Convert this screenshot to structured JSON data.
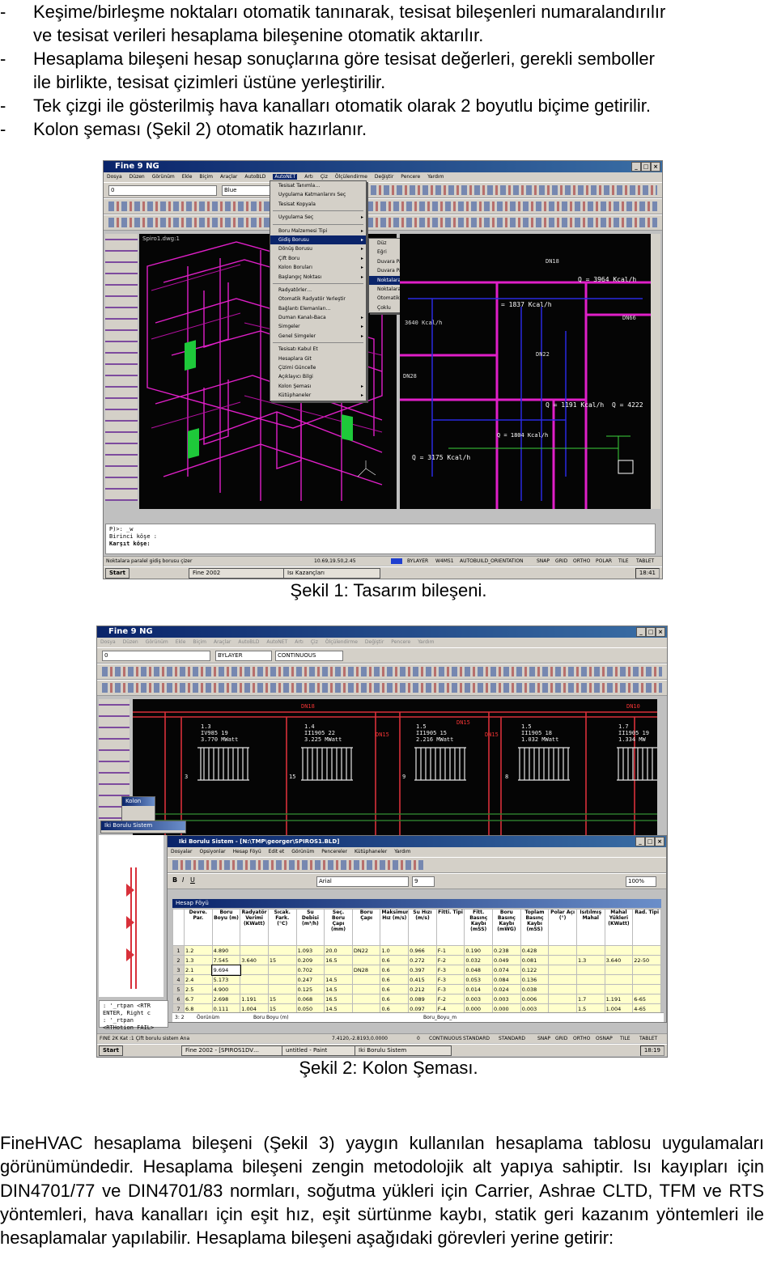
{
  "bullets": [
    {
      "dash": "-",
      "lines": [
        "Keşime/birleşme noktaları otomatik tanınarak, tesisat bileşenleri numaralandırılır",
        "ve tesisat verileri hesaplama bileşenine otomatik aktarılır."
      ]
    },
    {
      "dash": "-",
      "lines": [
        "Hesaplama bileşeni hesap sonuçlarına göre tesisat değerleri, gerekli semboller",
        "ile birlikte, tesisat çizimleri üstüne yerleştirilir."
      ]
    },
    {
      "dash": "-",
      "lines": [
        "Tek çizgi ile gösterilmiş hava kanalları otomatik olarak 2 boyutlu biçime getirilir."
      ]
    },
    {
      "dash": "-",
      "lines": [
        "Kolon şeması (Şekil 2) otomatik hazırlanır."
      ]
    }
  ],
  "figure1": {
    "caption": "Şekil 1: Tasarım bileşeni.",
    "app_title": "Fine 9 NG",
    "menubar": [
      "Dosya",
      "Düzen",
      "Görünüm",
      "Ekle",
      "Biçim",
      "Araçlar",
      "AutoBLD",
      "AutoNET",
      "Artı",
      "Çiz",
      "Ölçülendirme",
      "Değiştir",
      "Pencere",
      "Yardım"
    ],
    "layer_combo": "0",
    "color_combo": "Blue",
    "doc_title": "Spiro1.dwg:1",
    "main_menu": [
      "Tesisat Tanımla…",
      "Uygulama Katmanlarını Seç",
      "Tesisat Kopyala",
      "",
      "Uygulama Seç",
      "",
      "Boru Malzemesi Tipi",
      "Gidiş Borusu",
      "Dönüş Borusu",
      "Çift Boru",
      "Kolon Boruları",
      "Başlangıç Noktası",
      "",
      "Radyatörler…",
      "Otomatik Radyatör Yerleştir",
      "Bağlantı Elemanları…",
      "Duman Kanalı-Baca",
      "Simgeler",
      "Genel Simgeler",
      "",
      "Tesisatı Kabul Et",
      "Hesaplara Git",
      "Çizimi Güncelle",
      "Açıklayıcı Bilgi",
      "Kolon Şeması",
      "Kütüphaneler"
    ],
    "sub_menu": [
      "Düz",
      "Eğri",
      "Duvara Paralel",
      "Duvara Paralel, Radyatöre Bağlı",
      "Noktalara Paralel",
      "Noktalara Paralel, Radyatöre Bağlı",
      "Otomatik Radyatör Bağla",
      "Çoklu"
    ],
    "plan_labels": [
      "DN18",
      "Q = 3964 Kcal/h",
      "= 1837 Kcal/h",
      "3640 Kcal/h",
      "DN66",
      "DN22",
      "DN28",
      "Q = 1191 Kcal/h",
      "Q = 4222",
      "Q = 1804 Kcal/h",
      "Q = 3175 Kcal/h"
    ],
    "cmd_lines": [
      "P)>: _w",
      "Birinci köşe :",
      "Karşıt köşe:"
    ],
    "status_left": "Noktalara paralel gidiş borusu çizer",
    "status_coords": "10.69,19.50,2.45",
    "status_items": [
      "BYLAYER",
      "W4MS1",
      "AUTOBUILD_ORIENTATION",
      "SNAP",
      "GRID",
      "ORTHO",
      "POLAR",
      "TILE",
      "TABLET"
    ],
    "taskbar": {
      "start": "Start",
      "task1": "Fine 2002",
      "task2": "Isı Kazançları",
      "clock": "18:41"
    }
  },
  "figure2": {
    "caption": "Şekil 2: Kolon Şeması.",
    "app_title": "Fine 9 NG",
    "layer_combo": "0",
    "linetype_combo": "BYLAYER",
    "ltype2_combo": "CONTINUOUS",
    "riser_labels": [
      "DN18",
      "DN15",
      "DN15",
      "DN15",
      "DN10"
    ],
    "radiators": [
      {
        "id": "1.3",
        "code": "IV985 19",
        "power": "3.770 MWatt",
        "count": "3"
      },
      {
        "id": "1.4",
        "code": "II1905 22",
        "power": "3.225 MWatt",
        "count": "15"
      },
      {
        "id": "1.5",
        "code": "II1905 15",
        "power": "2.216 MWatt",
        "count": "9"
      },
      {
        "id": "1.5",
        "code": "II1905 18",
        "power": "1.032 MWatt",
        "count": "8"
      },
      {
        "id": "1.7",
        "code": "II1905 19",
        "power": "1.334 MW",
        "count": ""
      }
    ],
    "subwin_title": "Iki Borulu Sistem - [N:\\TMP\\georger\\SPIROS1.BLD]",
    "subwin_menu": [
      "Dosyalar",
      "Opsiyonlar",
      "Hesap Föyü",
      "Edit et",
      "Görünüm",
      "Pencereler",
      "Kütüphaneler",
      "Yardım"
    ],
    "font_combo": "Arial",
    "size_combo": "9",
    "zoom_combo": "100%",
    "sheet_title": "Hesap Föyü",
    "columns": [
      "Devre. Par.",
      "Boru Boyu (m)",
      "Radyatör Verimi (KWatt)",
      "Sıcak. Fark. (°C)",
      "Su Debisi (m³/h)",
      "Seç. Boru Çapı (mm)",
      "Boru Çapı",
      "Maksimum Hız (m/s)",
      "Su Hızı (m/s)",
      "Fitti. Tipi",
      "Fitt. Basınç Kaybı (mSS)",
      "Boru Basınç Kaybı (mWG)",
      "Toplam Basınç Kaybı (mSS)",
      "Polar Açı (°)",
      "Isıtılmış Mahal",
      "Mahal Yükleri (KWatt)",
      "Rad. Tipi"
    ],
    "rows": [
      {
        "n": "1",
        "c": [
          "1.2",
          "4.890",
          "",
          "",
          "1.093",
          "20.0",
          "DN22",
          "1.0",
          "0.966",
          "F-1",
          "0.190",
          "0.238",
          "0.428",
          "",
          "",
          "",
          ""
        ]
      },
      {
        "n": "2",
        "c": [
          "1.3",
          "7.545",
          "3.640",
          "15",
          "0.209",
          "16.5",
          "",
          "0.6",
          "0.272",
          "F-2",
          "0.032",
          "0.049",
          "0.081",
          "",
          "1.3",
          "3.640",
          "22-50"
        ]
      },
      {
        "n": "3",
        "c": [
          "2.1",
          "9.694",
          "",
          "",
          "0.702",
          "",
          "DN28",
          "0.6",
          "0.397",
          "F-3",
          "0.048",
          "0.074",
          "0.122",
          "",
          "",
          "",
          ""
        ]
      },
      {
        "n": "4",
        "c": [
          "2.4",
          "5.173",
          "",
          "",
          "0.247",
          "14.5",
          "",
          "0.6",
          "0.415",
          "F-3",
          "0.053",
          "0.084",
          "0.136",
          "",
          "",
          "",
          ""
        ]
      },
      {
        "n": "5",
        "c": [
          "2.5",
          "4.900",
          "",
          "",
          "0.125",
          "14.5",
          "",
          "0.6",
          "0.212",
          "F-3",
          "0.014",
          "0.024",
          "0.038",
          "",
          "",
          "",
          ""
        ]
      },
      {
        "n": "6",
        "c": [
          "6.7",
          "2.698",
          "1.191",
          "15",
          "0.068",
          "16.5",
          "",
          "0.6",
          "0.089",
          "F-2",
          "0.003",
          "0.003",
          "0.006",
          "",
          "1.7",
          "1.191",
          "6-65"
        ]
      },
      {
        "n": "7",
        "c": [
          "6.8",
          "0.111",
          "1.004",
          "15",
          "0.050",
          "14.5",
          "",
          "0.6",
          "0.097",
          "F-4",
          "0.000",
          "0.000",
          "0.003",
          "",
          "1.5",
          "1.004",
          "4-65"
        ]
      },
      {
        "n": "8",
        "c": [
          "6.11",
          "",
          "",
          "",
          "",
          "",
          "",
          "",
          "",
          "",
          "",
          "",
          "",
          "",
          "",
          "",
          ""
        ]
      }
    ],
    "panel_labels": [
      "Kolon",
      "Iki Borulu Sistem"
    ],
    "sheet_footer": {
      "cell": "3: 2",
      "name": "Öorünüm",
      "field1": "Boru Boyu (m)",
      "field2": "Boru_Boyu_m"
    },
    "cmd_lines": [
      ": '_rtpan <RTR",
      "ENTER, Right c",
      ": '_rtpan <RTHotion FAIL>"
    ],
    "status_left": "FINE 2K Kat :1 Çift borulu sistem Ana",
    "status_coords": "7.4120,-2.8193,0.0000",
    "status_items": [
      "0",
      "CONTINUOUS",
      "STANDARD",
      "STANDARD",
      "SNAP",
      "GRID",
      "ORTHO",
      "OSNAP",
      "TILE",
      "TABLET"
    ],
    "taskbar": {
      "start": "Start",
      "task1": "Fine 2002 - [SPIROS1DV…",
      "task2": "untitled - Paint",
      "task3": "Iki Borulu Sistem",
      "clock": "18:19"
    }
  },
  "paragraph": "FineHVAC hesaplama bileşeni (Şekil 3) yaygın kullanılan hesaplama tablosu uygulamaları görünümündedir. Hesaplama bileşeni zengin metodolojik alt yapıya sahiptir. Isı kayıpları için DIN4701/77 ve DIN4701/83 normları, soğutma yükleri için Carrier, Ashrae CLTD, TFM ve RTS yöntemleri, hava kanalları için eşit hız, eşit sürtünme kaybı, statik geri kazanım yöntemleri ile hesaplamalar yapılabilir. Hesaplama bileşeni aşağıdaki görevleri yerine getirir:"
}
